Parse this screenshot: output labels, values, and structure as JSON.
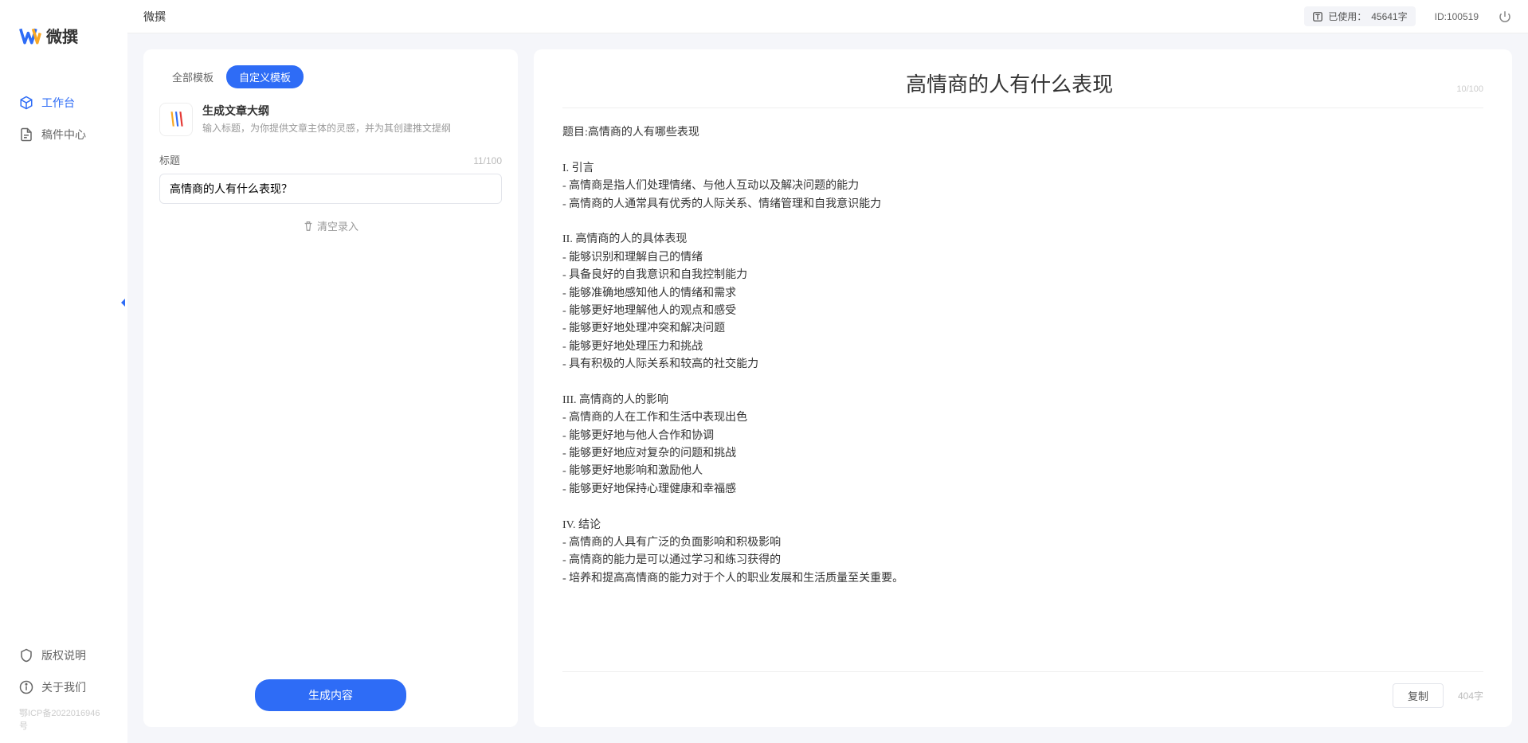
{
  "brand": {
    "name": "微撰"
  },
  "topbar": {
    "title": "微撰",
    "usage_prefix": "已使用：",
    "usage_value": "45641字",
    "id_label": "ID:100519"
  },
  "sidebar": {
    "items": [
      {
        "label": "工作台",
        "active": true
      },
      {
        "label": "稿件中心",
        "active": false
      }
    ],
    "bottom": [
      {
        "label": "版权说明"
      },
      {
        "label": "关于我们"
      }
    ],
    "icp": "鄂ICP备2022016946号"
  },
  "left_panel": {
    "tabs": [
      {
        "label": "全部模板",
        "active": false
      },
      {
        "label": "自定义模板",
        "active": true
      }
    ],
    "template": {
      "title": "生成文章大纲",
      "desc": "输入标题，为你提供文章主体的灵感，并为其创建推文提纲"
    },
    "field": {
      "label": "标题",
      "counter": "11/100",
      "value": "高情商的人有什么表现？"
    },
    "clear_label": "清空录入",
    "generate_label": "生成内容"
  },
  "right_panel": {
    "title": "高情商的人有什么表现",
    "title_counter": "10/100",
    "body": "题目:高情商的人有哪些表现\n\nI. 引言\n- 高情商是指人们处理情绪、与他人互动以及解决问题的能力\n- 高情商的人通常具有优秀的人际关系、情绪管理和自我意识能力\n\nII. 高情商的人的具体表现\n- 能够识别和理解自己的情绪\n- 具备良好的自我意识和自我控制能力\n- 能够准确地感知他人的情绪和需求\n- 能够更好地理解他人的观点和感受\n- 能够更好地处理冲突和解决问题\n- 能够更好地处理压力和挑战\n- 具有积极的人际关系和较高的社交能力\n\nIII. 高情商的人的影响\n- 高情商的人在工作和生活中表现出色\n- 能够更好地与他人合作和协调\n- 能够更好地应对复杂的问题和挑战\n- 能够更好地影响和激励他人\n- 能够更好地保持心理健康和幸福感\n\nIV. 结论\n- 高情商的人具有广泛的负面影响和积极影响\n- 高情商的能力是可以通过学习和练习获得的\n- 培养和提高高情商的能力对于个人的职业发展和生活质量至关重要。",
    "copy_label": "复制",
    "word_count": "404字"
  }
}
